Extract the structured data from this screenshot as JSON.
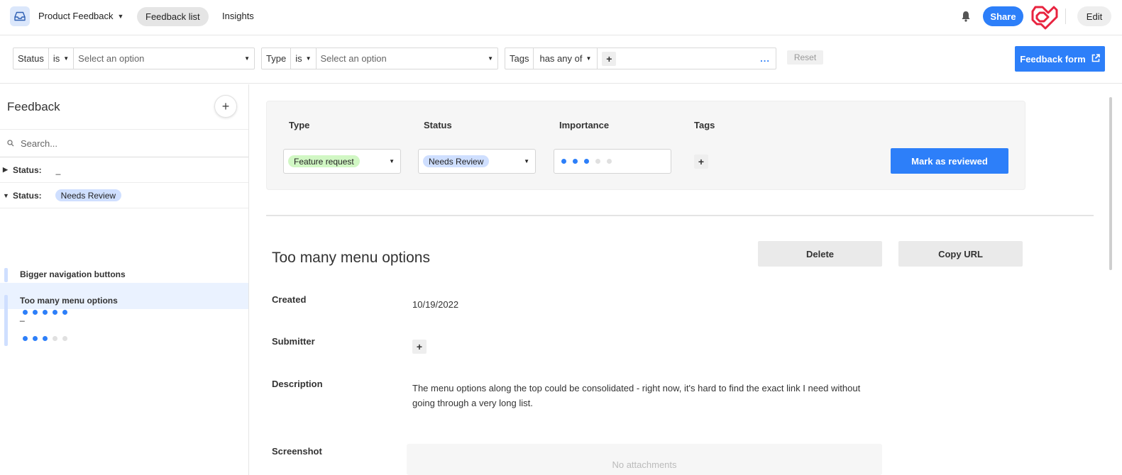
{
  "header": {
    "app_name": "Product Feedback",
    "tabs": [
      "Feedback list",
      "Insights"
    ],
    "share_label": "Share",
    "edit_label": "Edit"
  },
  "filters": {
    "status": {
      "field": "Status",
      "op": "is",
      "placeholder": "Select an option"
    },
    "type": {
      "field": "Type",
      "op": "is",
      "placeholder": "Select an option"
    },
    "tags": {
      "field": "Tags",
      "op": "has any of",
      "more": "..."
    },
    "reset_label": "Reset",
    "form_label": "Feedback form"
  },
  "sidebar": {
    "title": "Feedback",
    "search_placeholder": "Search...",
    "groups": [
      {
        "label": "Status:",
        "value": "_",
        "expanded": false
      },
      {
        "label": "Status:",
        "value": "Needs Review",
        "expanded": true
      }
    ],
    "records": [
      {
        "title": "Bigger navigation buttons"
      },
      {
        "title": "Too many menu options",
        "empty_value": "_",
        "rating_a": 5,
        "rating_b": 3,
        "rating_max": 5
      }
    ]
  },
  "record": {
    "fields": {
      "type_label": "Type",
      "status_label": "Status",
      "importance_label": "Importance",
      "tags_label": "Tags"
    },
    "type_value": "Feature request",
    "status_value": "Needs Review",
    "importance": 3,
    "importance_max": 5,
    "review_button": "Mark as reviewed",
    "title": "Too many menu options",
    "delete_label": "Delete",
    "copy_label": "Copy URL",
    "created_label": "Created",
    "created_value": "10/19/2022",
    "submitter_label": "Submitter",
    "description_label": "Description",
    "description_line1": "The menu options along the top could be consolidated - right now, it's hard to find the exact link I need without",
    "description_line2": "going through a very long list.",
    "screenshot_label": "Screenshot",
    "attachments_empty": "No attachments"
  },
  "colors": {
    "accent": "#2d7ff9",
    "pill_blue": "#cfdfff",
    "pill_green": "#d1f7c4",
    "logo_red": "#e8233f"
  },
  "icons": [
    "inbox-icon",
    "chevron-down-icon",
    "bell-icon",
    "logo-icon",
    "search-icon",
    "external-link-icon",
    "plus-icon",
    "triangle-right-icon",
    "triangle-down-icon"
  ]
}
